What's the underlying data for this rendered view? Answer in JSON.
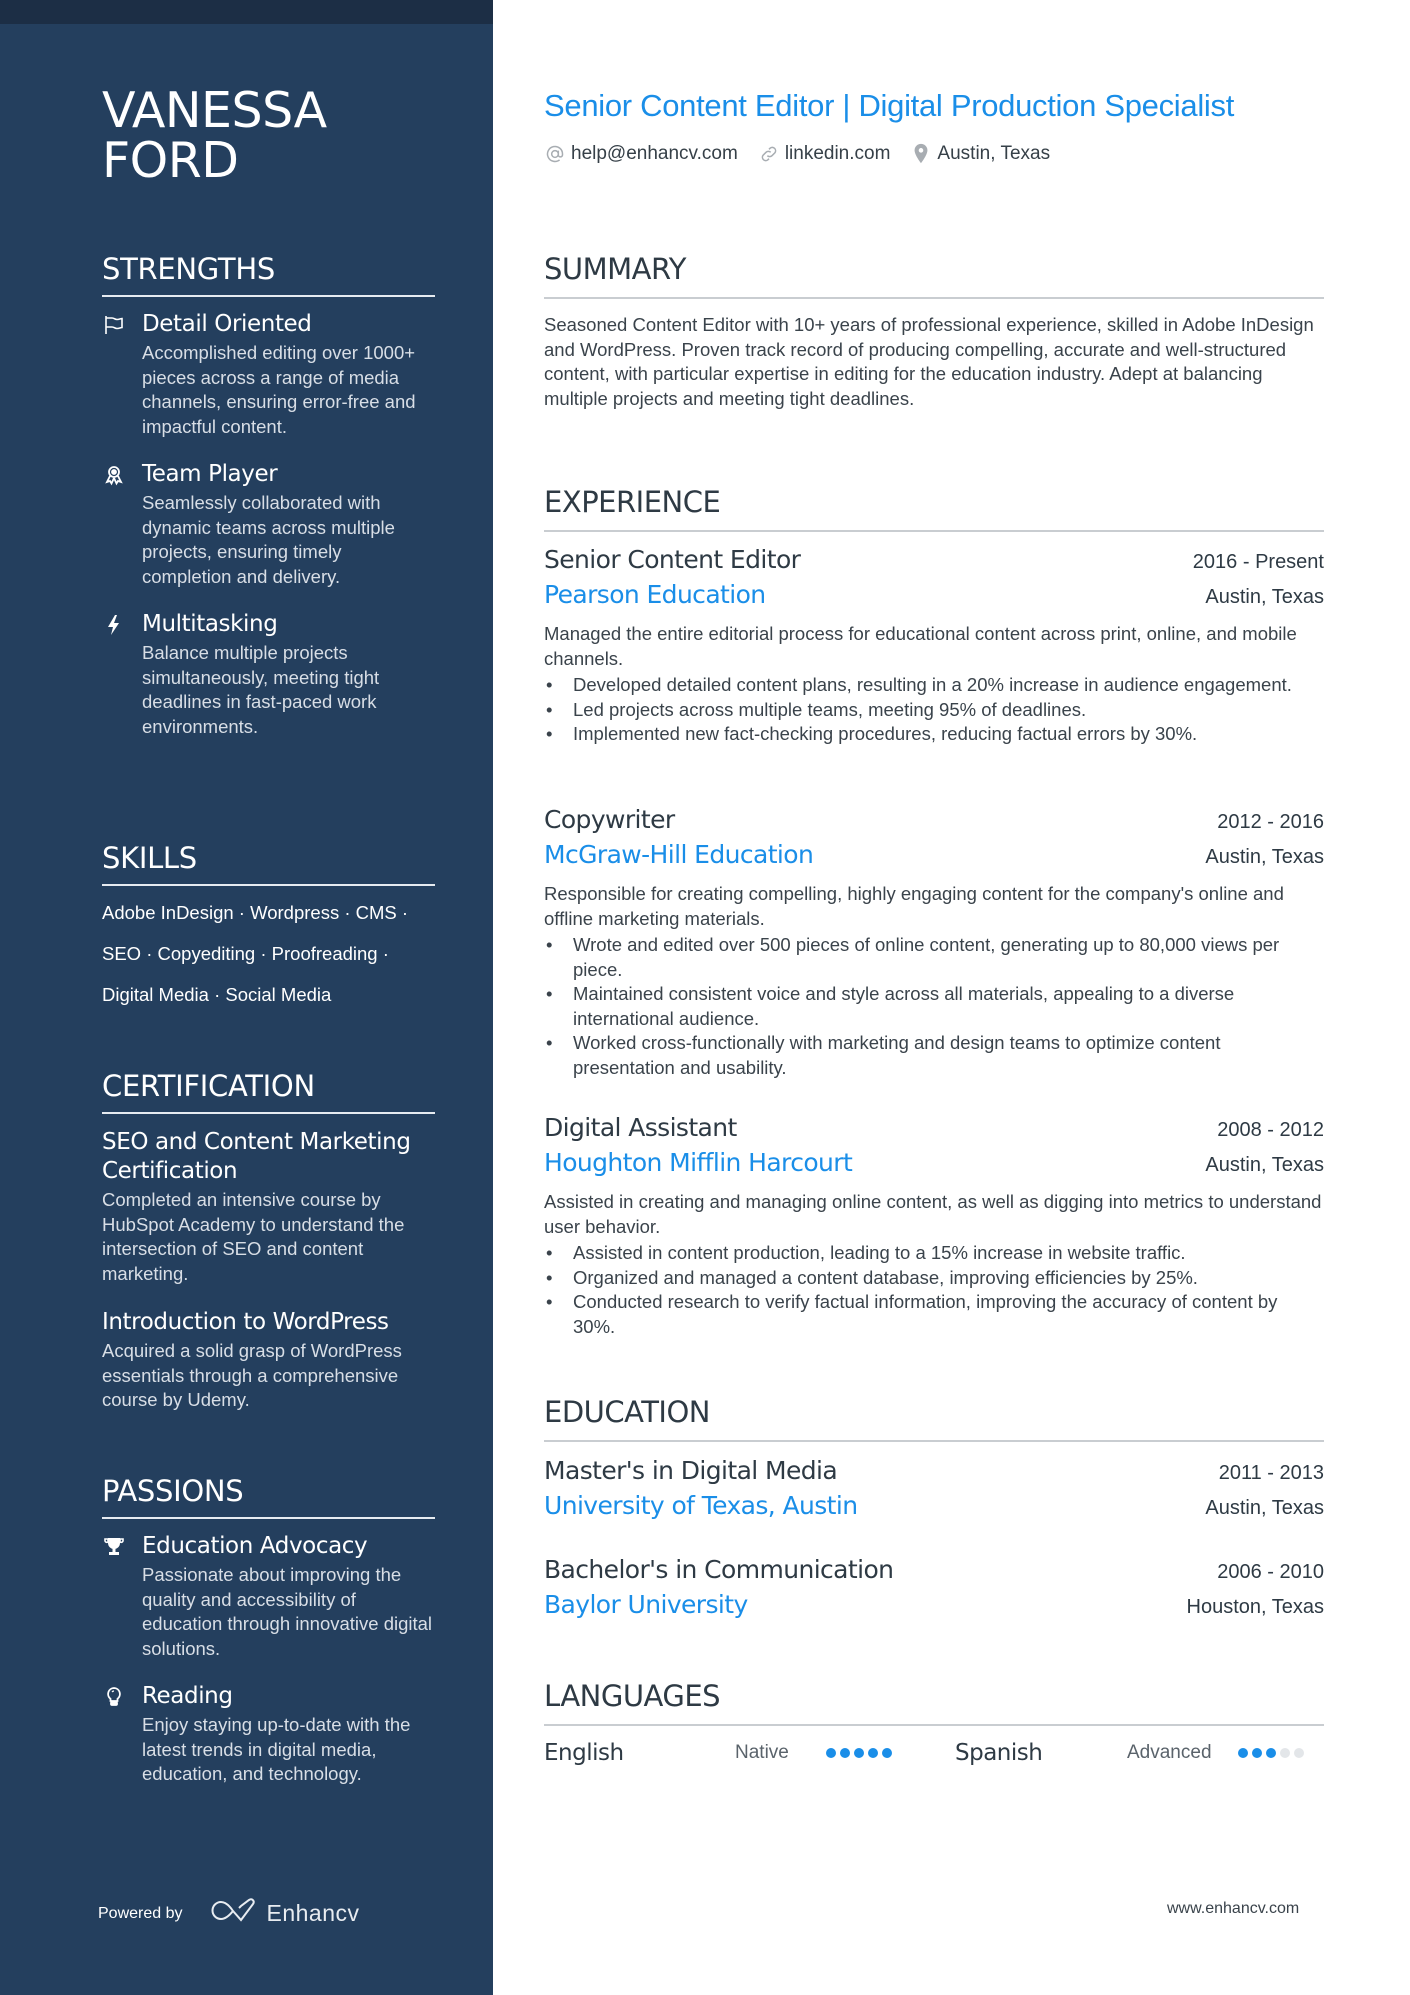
{
  "colors": {
    "sidebar_bg": "#243f5e",
    "accent": "#1a8ee8",
    "dot_filled": "#1a8ee8",
    "dot_empty": "#e3e6e9"
  },
  "profile": {
    "name_line1": "VANESSA",
    "name_line2": "FORD",
    "title": "Senior Content Editor | Digital Production Specialist",
    "contact": [
      {
        "icon": "at-icon",
        "text": "help@enhancv.com"
      },
      {
        "icon": "link-icon",
        "text": "linkedin.com"
      },
      {
        "icon": "location-pin-icon",
        "text": "Austin, Texas"
      }
    ]
  },
  "sidebar": {
    "strengths": {
      "heading": "STRENGTHS",
      "items": [
        {
          "icon": "flag-icon",
          "title": "Detail Oriented",
          "desc": "Accomplished editing over 1000+ pieces across a range of media channels, ensuring error-free and impactful content."
        },
        {
          "icon": "award-ribbon-icon",
          "title": "Team Player",
          "desc": "Seamlessly collaborated with dynamic teams across multiple projects, ensuring timely completion and delivery."
        },
        {
          "icon": "lightning-bolt-icon",
          "title": "Multitasking",
          "desc": "Balance multiple projects simultaneously, meeting tight deadlines in fast-paced work environments."
        }
      ]
    },
    "skills": {
      "heading": "SKILLS",
      "lines": [
        "Adobe InDesign · Wordpress · CMS ·",
        "SEO · Copyediting · Proofreading ·",
        "Digital Media · Social Media"
      ]
    },
    "certification": {
      "heading": "CERTIFICATION",
      "items": [
        {
          "title": "SEO and Content Marketing Certification",
          "desc": "Completed an intensive course by HubSpot Academy to understand the intersection of SEO and content marketing."
        },
        {
          "title": "Introduction to WordPress",
          "desc": "Acquired a solid grasp of WordPress essentials through a comprehensive course by Udemy."
        }
      ]
    },
    "passions": {
      "heading": "PASSIONS",
      "items": [
        {
          "icon": "trophy-icon",
          "title": "Education Advocacy",
          "desc": "Passionate about improving the quality and accessibility of education through innovative digital solutions."
        },
        {
          "icon": "lightbulb-icon",
          "title": "Reading",
          "desc": "Enjoy staying up-to-date with the latest trends in digital media, education, and technology."
        }
      ]
    },
    "powered_by": "Powered by",
    "brand": "Enhancv"
  },
  "summary": {
    "heading": "SUMMARY",
    "text": "Seasoned Content Editor with 10+ years of professional experience, skilled in Adobe InDesign and WordPress. Proven track record of producing compelling, accurate and well-structured content, with particular expertise in editing for the education industry. Adept at balancing multiple projects and meeting tight deadlines."
  },
  "experience": {
    "heading": "EXPERIENCE",
    "jobs": [
      {
        "title": "Senior Content Editor",
        "dates": "2016 - Present",
        "company": "Pearson Education",
        "location": "Austin, Texas",
        "desc": "Managed the entire editorial process for educational content across print, online, and mobile channels.",
        "bullets": [
          "Developed detailed content plans, resulting in a 20% increase in audience engagement.",
          "Led projects across multiple teams, meeting 95% of deadlines.",
          "Implemented new fact-checking procedures, reducing factual errors by 30%."
        ]
      },
      {
        "title": "Copywriter",
        "dates": "2012 - 2016",
        "company": "McGraw-Hill Education",
        "location": "Austin, Texas",
        "desc": "Responsible for creating compelling, highly engaging content for the company's online and offline marketing materials.",
        "bullets": [
          "Wrote and edited over 500 pieces of online content, generating up to 80,000 views per piece.",
          "Maintained consistent voice and style across all materials, appealing to a diverse international audience.",
          "Worked cross-functionally with marketing and design teams to optimize content presentation and usability."
        ]
      },
      {
        "title": "Digital Assistant",
        "dates": "2008 - 2012",
        "company": "Houghton Mifflin Harcourt",
        "location": "Austin, Texas",
        "desc": "Assisted in creating and managing online content, as well as digging into metrics to understand user behavior.",
        "bullets": [
          "Assisted in content production, leading to a 15% increase in website traffic.",
          "Organized and managed a content database, improving efficiencies by 25%.",
          "Conducted research to verify factual information, improving the accuracy of content by 30%."
        ]
      }
    ]
  },
  "education": {
    "heading": "EDUCATION",
    "items": [
      {
        "degree": "Master's in Digital Media",
        "dates": "2011 - 2013",
        "school": "University of Texas, Austin",
        "location": "Austin, Texas"
      },
      {
        "degree": "Bachelor's in Communication",
        "dates": "2006 - 2010",
        "school": "Baylor University",
        "location": "Houston, Texas"
      }
    ]
  },
  "languages": {
    "heading": "LANGUAGES",
    "items": [
      {
        "name": "English",
        "level": "Native",
        "rating": 5,
        "max": 5
      },
      {
        "name": "Spanish",
        "level": "Advanced",
        "rating": 3,
        "max": 5
      }
    ]
  },
  "footer": {
    "url": "www.enhancv.com"
  }
}
